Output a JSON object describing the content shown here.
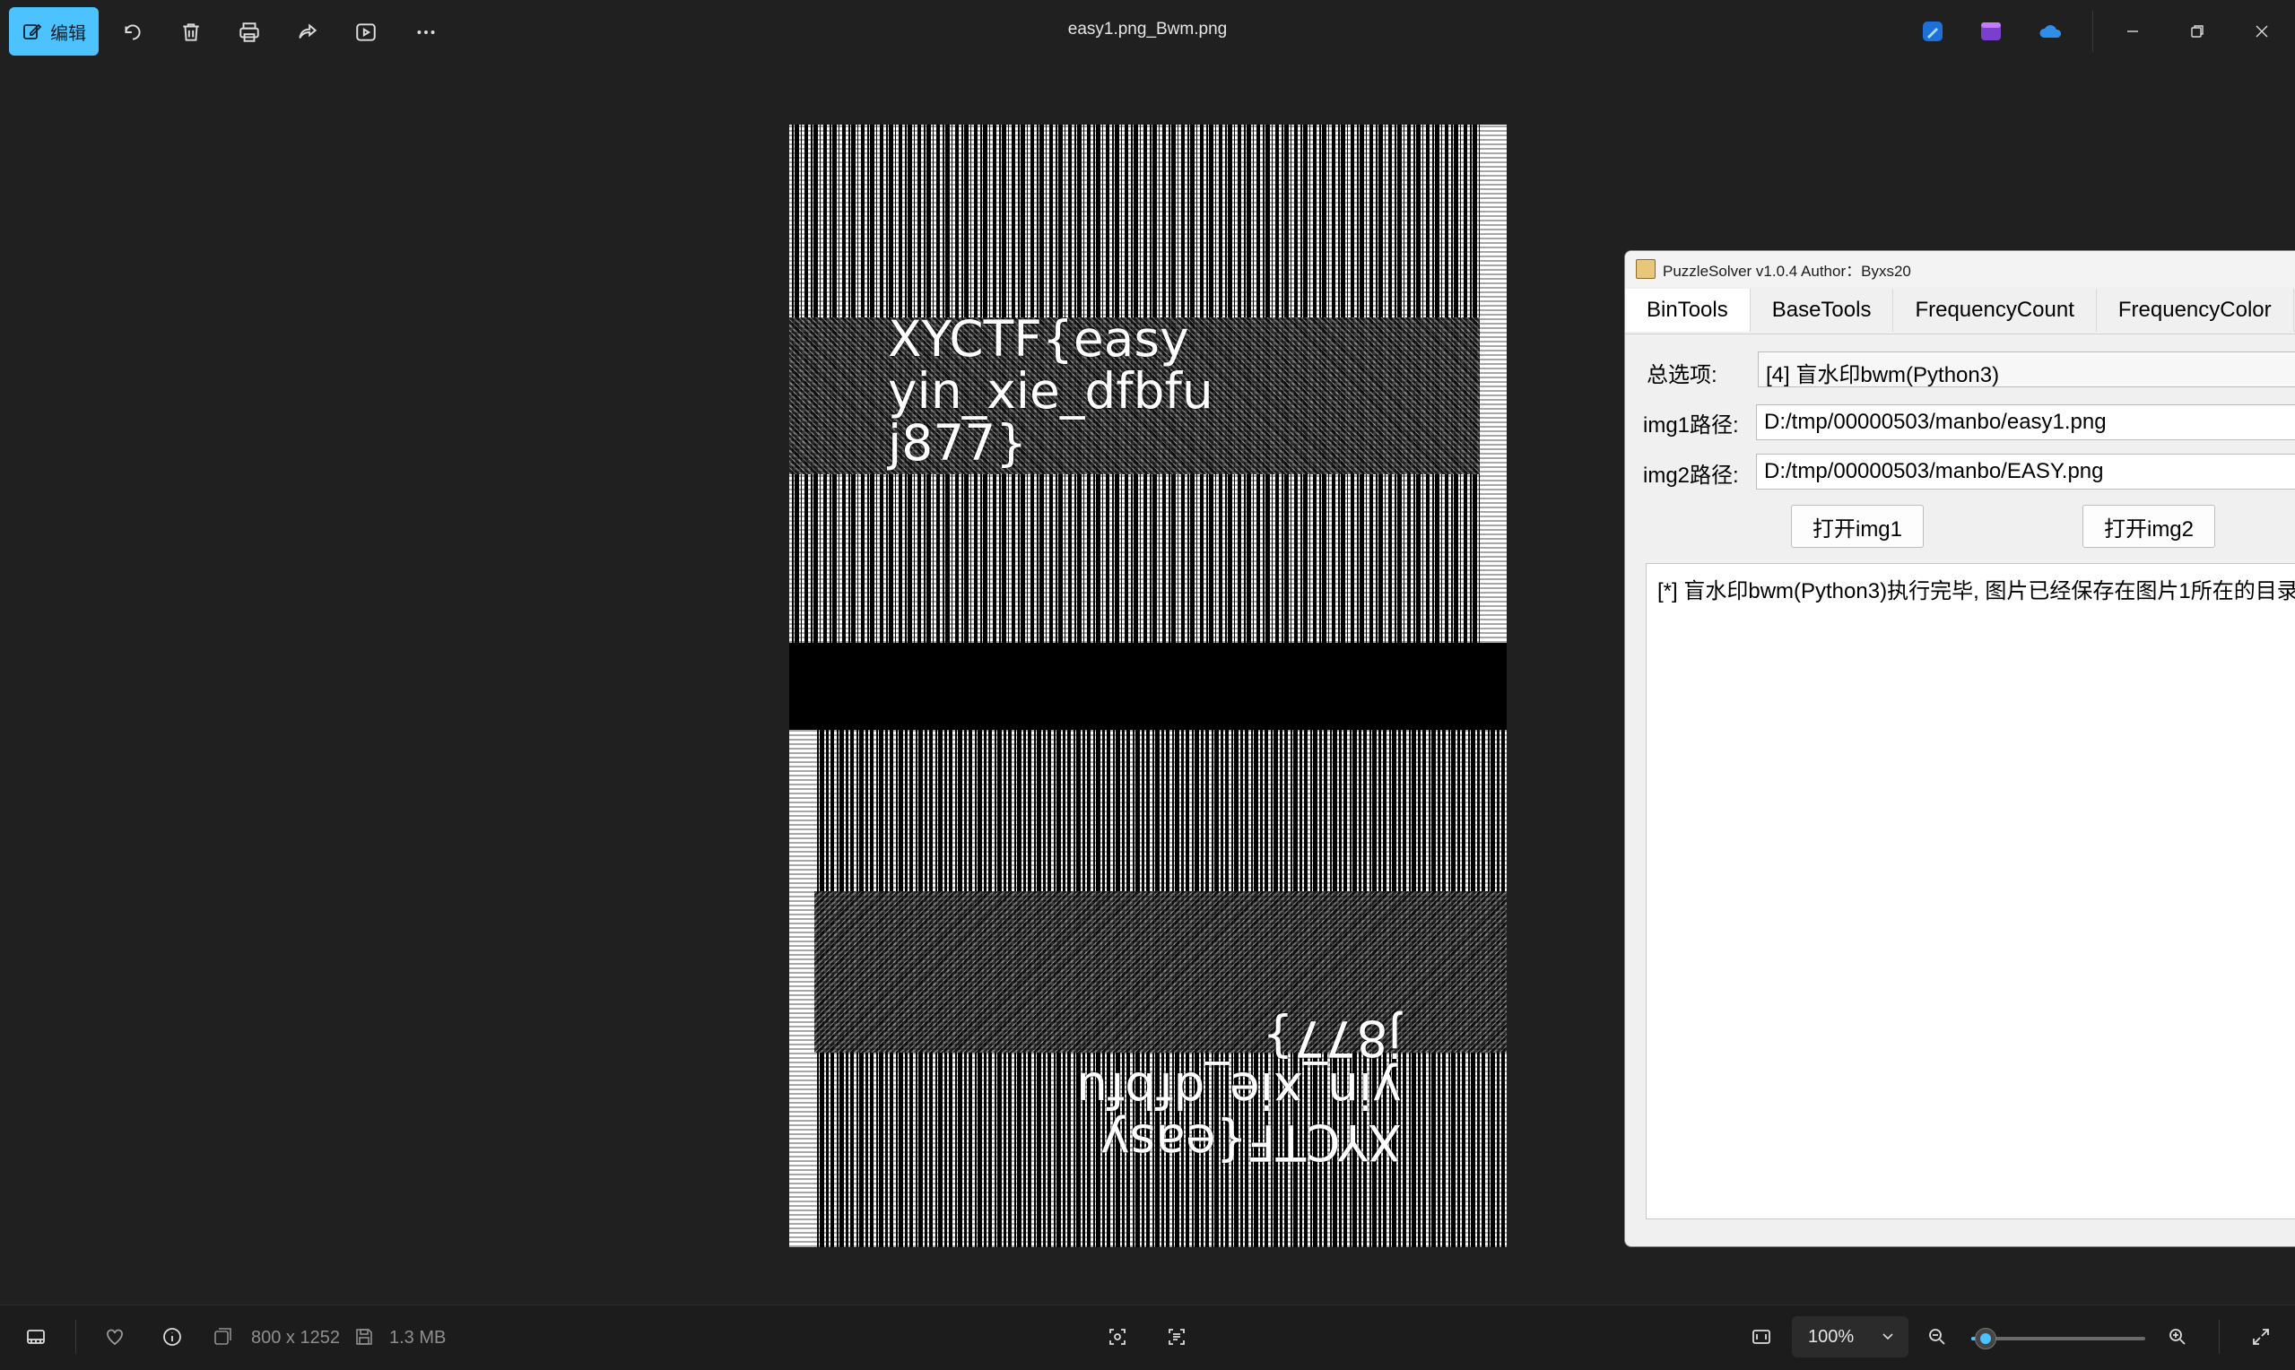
{
  "toolbar": {
    "edit_label": "编辑",
    "file_title": "easy1.png_Bwm.png",
    "icons": [
      "edit-icon",
      "rotate-icon",
      "delete-icon",
      "print-icon",
      "share-icon",
      "slideshow-icon",
      "more-icon",
      "designer-icon",
      "clipchamp-icon",
      "onedrive-icon",
      "minimize-icon",
      "restore-icon",
      "close-icon"
    ]
  },
  "photo": {
    "watermark_top": "XYCTF{easy\nyin_xie_dfbfu\nj877}",
    "watermark_bottom": "XYCTF{easy\nyin_xie_dfbfu\nj877}"
  },
  "puzzlesolver": {
    "title": "PuzzleSolver v1.0.4  Author：Byxs20",
    "tabs": [
      "BinTools",
      "BaseTools",
      "FrequencyCount",
      "FrequencyColor"
    ],
    "option_label": "总选项:",
    "option_value": "[4] 盲水印bwm(Python3)",
    "img1_label": "img1路径:",
    "img1_value": "D:/tmp/00000503/manbo/easy1.png",
    "img2_label": "img2路径:",
    "img2_value": "D:/tmp/00000503/manbo/EASY.png",
    "open_img1": "打开img1",
    "open_img2": "打开img2",
    "output": "[*] 盲水印bwm(Python3)执行完毕, 图片已经保存在图片1所在的目录"
  },
  "statusbar": {
    "dimensions": "800 x 1252",
    "filesize": "1.3 MB",
    "zoom": "100%",
    "zoom_level_percent": 8
  }
}
